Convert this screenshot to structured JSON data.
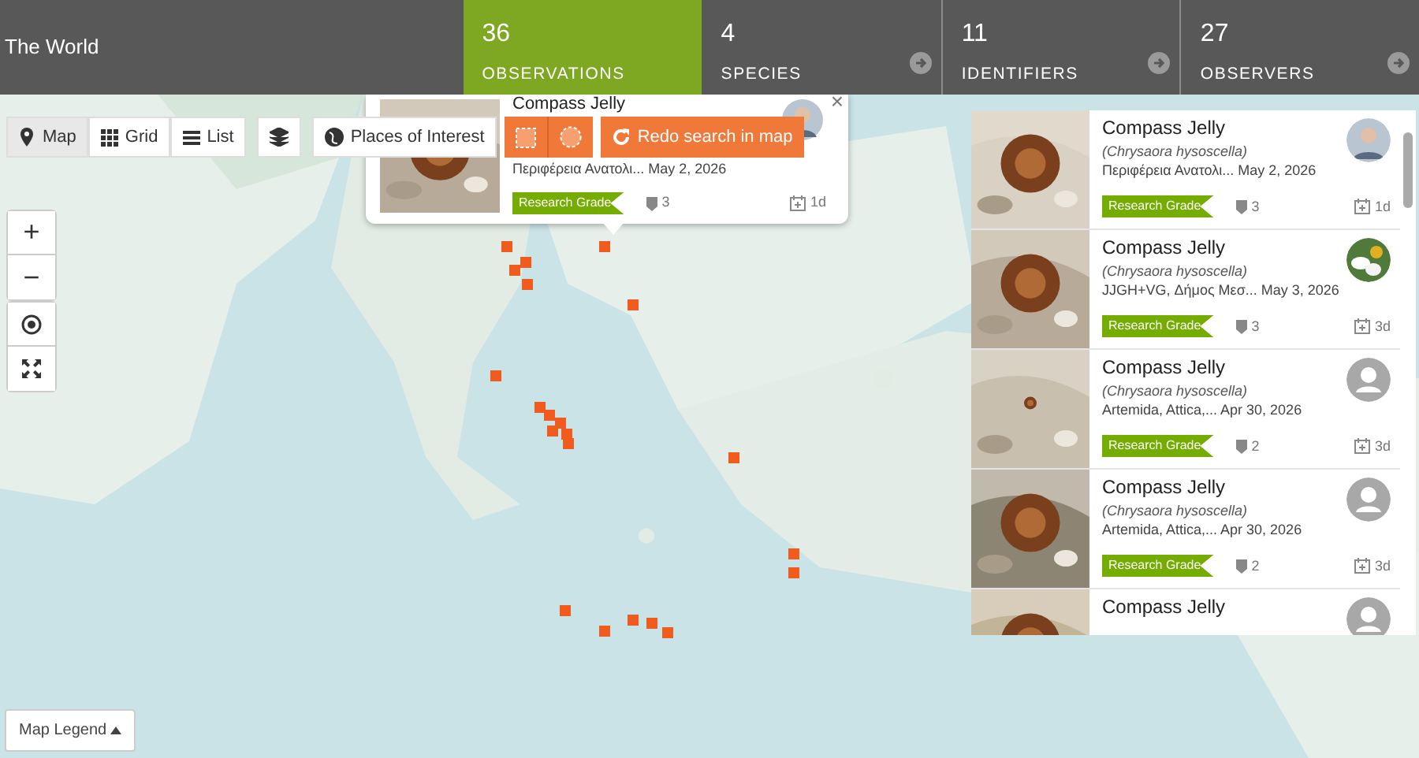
{
  "header": {
    "title": "The World"
  },
  "tabs": [
    {
      "count": "36",
      "label": "OBSERVATIONS",
      "selected": true
    },
    {
      "count": "4",
      "label": "SPECIES",
      "selected": false
    },
    {
      "count": "11",
      "label": "IDENTIFIERS",
      "selected": false
    },
    {
      "count": "27",
      "label": "OBSERVERS",
      "selected": false
    }
  ],
  "view_buttons": [
    {
      "label": "Map",
      "selected": true
    },
    {
      "label": "Grid",
      "selected": false
    },
    {
      "label": "List",
      "selected": false
    }
  ],
  "places_button": "Places of Interest",
  "redo_button": "Redo search in map",
  "popup": {
    "title": "Compass Jelly",
    "place": "Περιφέρεια Ανατολι...",
    "date": "May 2, 2026",
    "grade": "Research Grade",
    "ids": "3",
    "age": "1d",
    "close": "×"
  },
  "zoom_buttons": [
    "+",
    "−"
  ],
  "legend_button": "Map Legend",
  "results": [
    {
      "title": "Compass Jelly",
      "species": "(Chrysaora hysoscella)",
      "place": "Περιφέρεια Ανατολι...",
      "date": "May 2, 2026",
      "grade": "Research Grade",
      "ids": "3",
      "age": "1d"
    },
    {
      "title": "Compass Jelly",
      "species": "(Chrysaora hysoscella)",
      "place": "JJGH+VG, Δήμος Μεσ...",
      "date": "May 3, 2026",
      "grade": "Research Grade",
      "ids": "3",
      "age": "3d",
      "kind": "flower"
    },
    {
      "title": "Compass Jelly",
      "species": "(Chrysaora hysoscella)",
      "place": "Artemida, Attica,...",
      "date": "Apr 30, 2026",
      "grade": "Research Grade",
      "ids": "2",
      "age": "3d",
      "kind": "default"
    },
    {
      "title": "Compass Jelly",
      "species": "(Chrysaora hysoscella)",
      "place": "Artemida, Attica,...",
      "date": "Apr 30, 2026",
      "grade": "Research Grade",
      "ids": "2",
      "age": "3d",
      "kind": "default"
    },
    {
      "title": "Compass Jelly",
      "kind": "default"
    }
  ]
}
